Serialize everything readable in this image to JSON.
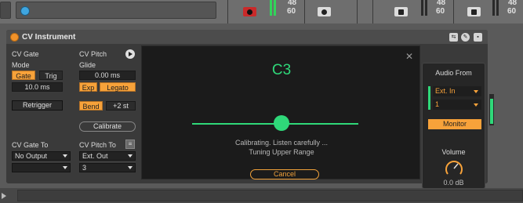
{
  "top": {
    "meters": [
      {
        "value_top": "48",
        "value_bottom": "60"
      },
      {
        "value_top": "48",
        "value_bottom": "60"
      },
      {
        "value_top": "48",
        "value_bottom": "60"
      }
    ]
  },
  "device": {
    "title": "CV Instrument"
  },
  "cv_gate": {
    "label": "CV Gate",
    "mode_label": "Mode",
    "gate": "Gate",
    "trig": "Trig",
    "duration": "10.0 ms",
    "retrigger": "Retrigger",
    "to_label": "CV Gate To",
    "output": "No Output"
  },
  "cv_pitch": {
    "label": "CV Pitch",
    "glide_label": "Glide",
    "glide_value": "0.00 ms",
    "exp": "Exp",
    "legato": "Legato",
    "bend": "Bend",
    "bend_range": "+2 st",
    "calibrate": "Calibrate",
    "to_label": "CV Pitch To",
    "output": "Ext. Out",
    "channel": "3"
  },
  "modal": {
    "note": "C3",
    "line1": "Calibrating. Listen carefully ...",
    "line2": "Tuning Upper Range",
    "cancel": "Cancel",
    "pages": 5,
    "active_page": 5
  },
  "audio_from": {
    "label": "Audio From",
    "input": "Ext. In",
    "channel": "1",
    "monitor": "Monitor",
    "volume_label": "Volume",
    "volume_value": "0.0 dB"
  },
  "colors": {
    "accent": "#f7a23a",
    "green": "#2fd879"
  }
}
